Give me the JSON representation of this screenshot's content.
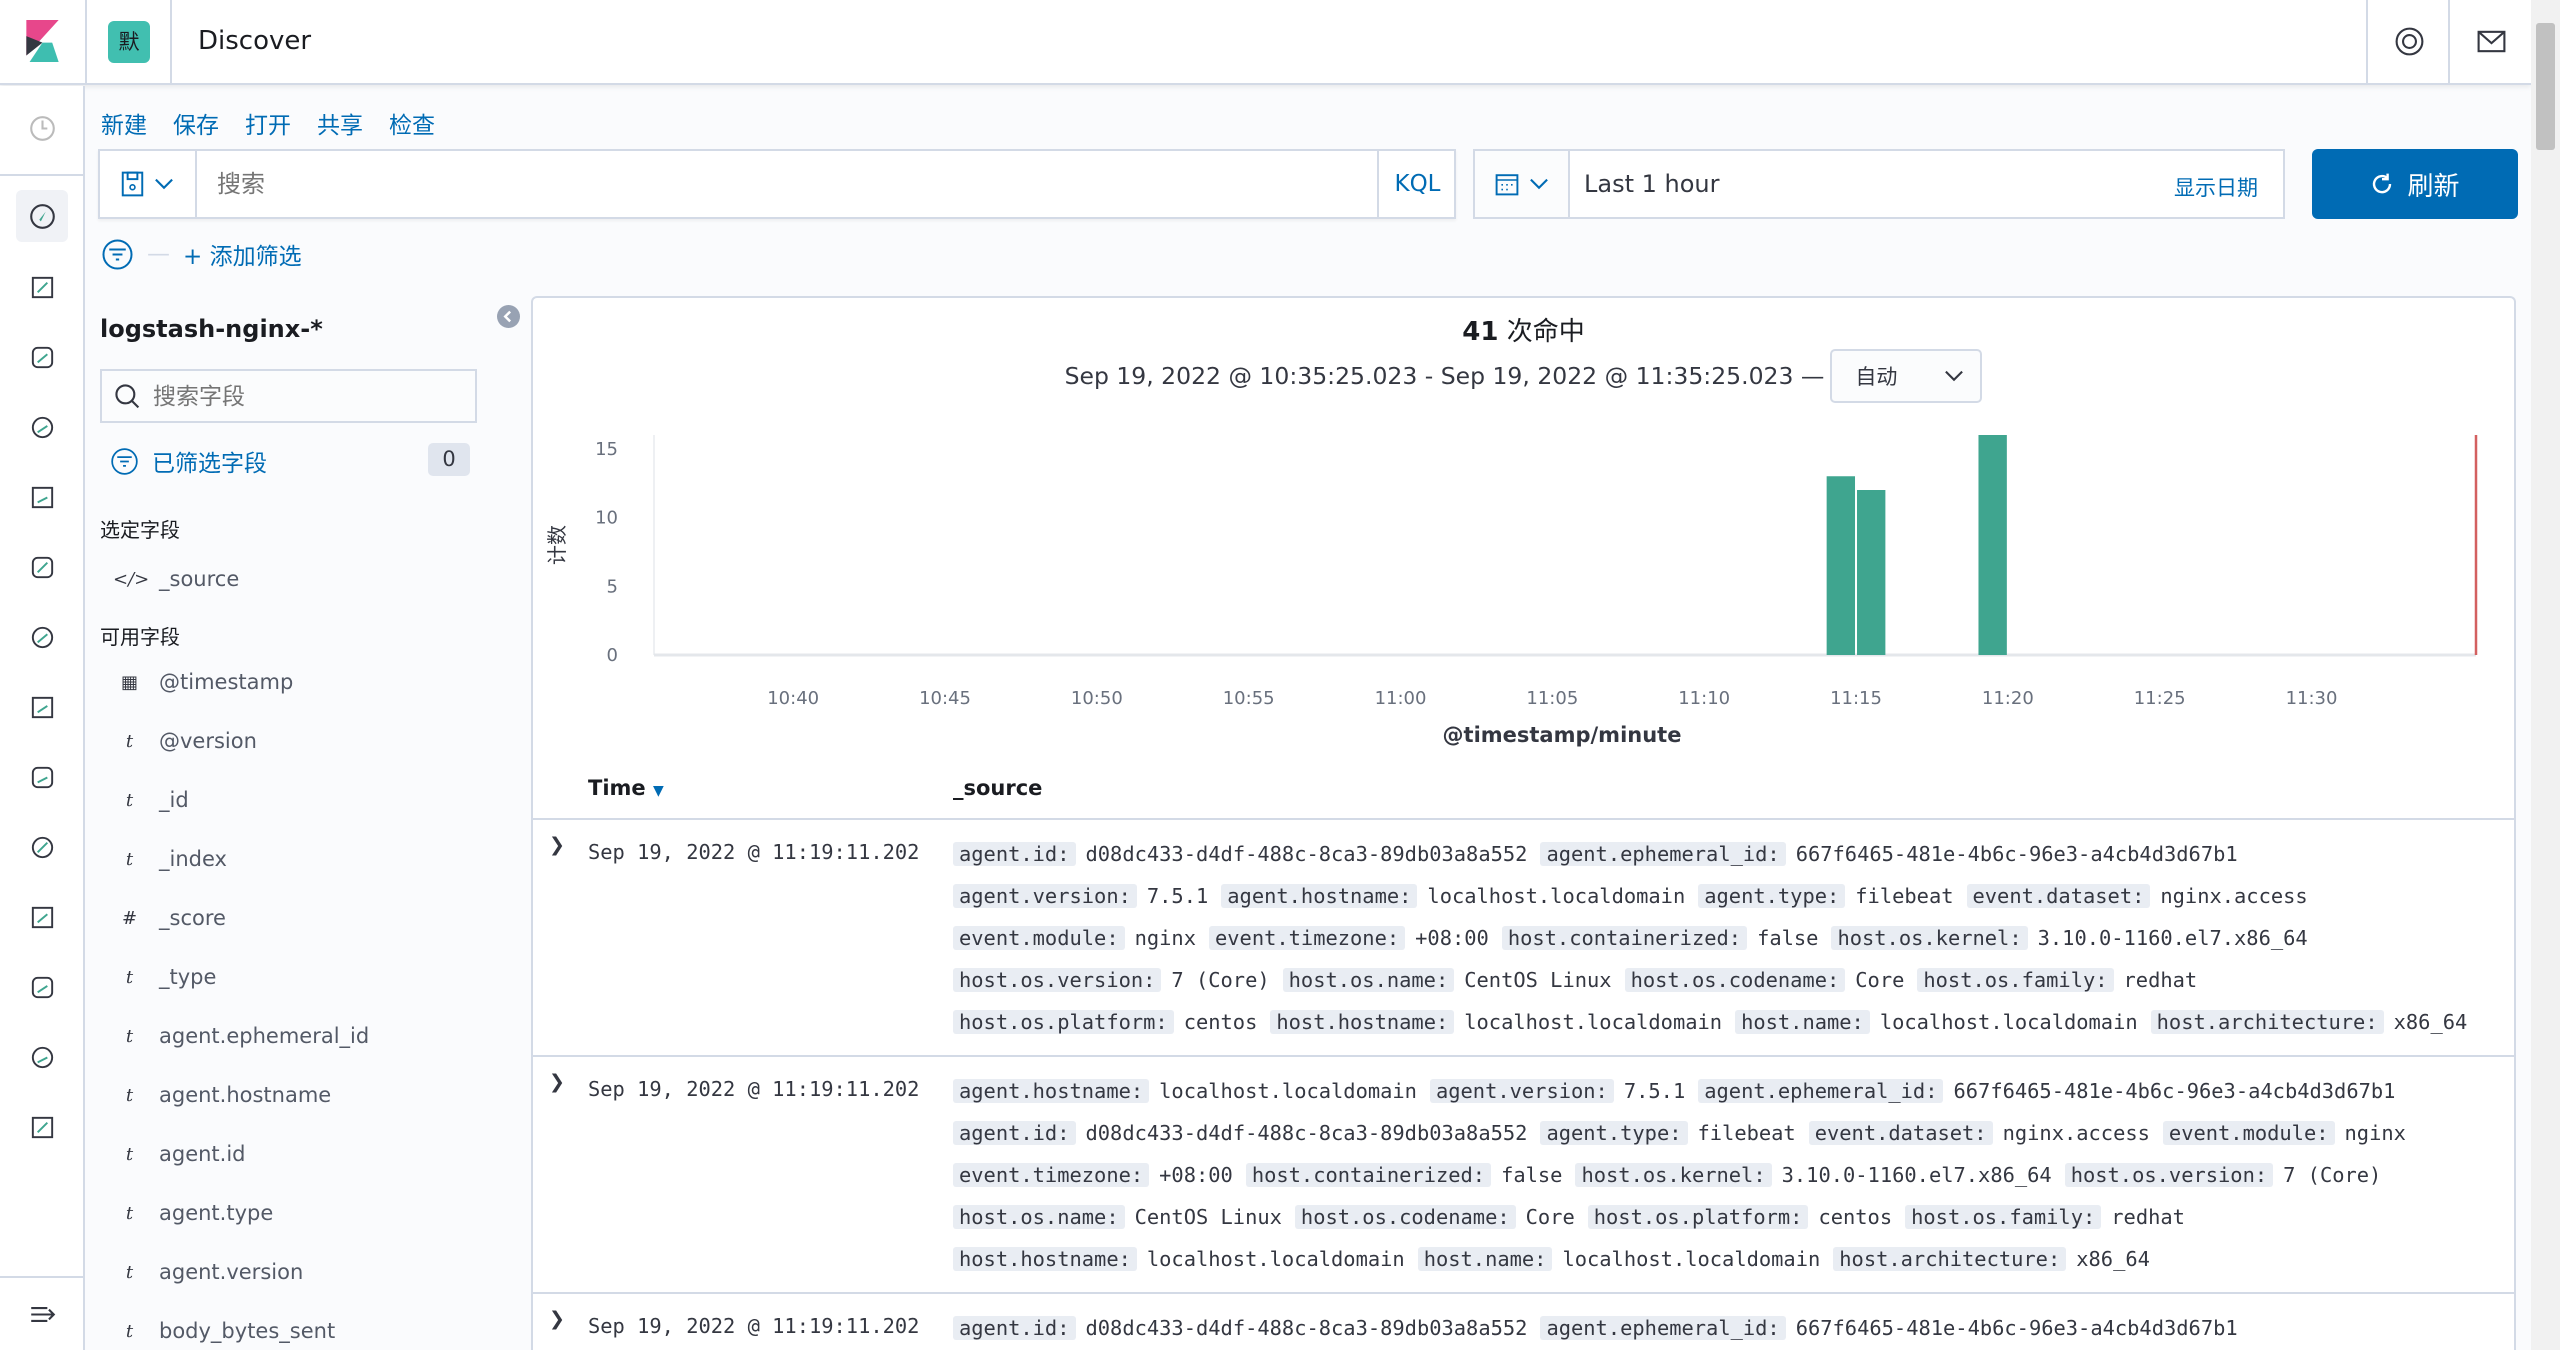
{
  "header": {
    "space_badge": "默",
    "title": "Discover",
    "icons": [
      "help-icon",
      "mail-icon"
    ]
  },
  "menu": {
    "items": [
      "新建",
      "保存",
      "打开",
      "共享",
      "检查"
    ]
  },
  "query": {
    "placeholder": "搜索",
    "language": "KQL"
  },
  "date": {
    "value": "Last 1 hour",
    "show_dates": "显示日期",
    "refresh": "刷新"
  },
  "filters": {
    "add": "+ 添加筛选"
  },
  "sidebar": {
    "index_pattern": "logstash-nginx-*",
    "search_placeholder": "搜索字段",
    "filtered_label": "已筛选字段",
    "filtered_count": "0",
    "selected_title": "选定字段",
    "selected": [
      {
        "type": "source",
        "name": "_source"
      }
    ],
    "available_title": "可用字段",
    "available": [
      {
        "type": "date",
        "name": "@timestamp"
      },
      {
        "type": "t",
        "name": "@version"
      },
      {
        "type": "t",
        "name": "_id"
      },
      {
        "type": "t",
        "name": "_index"
      },
      {
        "type": "#",
        "name": "_score"
      },
      {
        "type": "t",
        "name": "_type"
      },
      {
        "type": "t",
        "name": "agent.ephemeral_id"
      },
      {
        "type": "t",
        "name": "agent.hostname"
      },
      {
        "type": "t",
        "name": "agent.id"
      },
      {
        "type": "t",
        "name": "agent.type"
      },
      {
        "type": "t",
        "name": "agent.version"
      },
      {
        "type": "t",
        "name": "body_bytes_sent"
      }
    ]
  },
  "hits": {
    "count": "41",
    "label": "次命中",
    "range": "Sep 19, 2022 @ 10:35:25.023 - Sep 19, 2022 @ 11:35:25.023 —",
    "interval": "自动"
  },
  "chart_data": {
    "type": "bar",
    "xlabel": "@timestamp/minute",
    "ylabel": "计数",
    "x_range": [
      "10:35:25",
      "11:35:25"
    ],
    "ylim": [
      0,
      16
    ],
    "y_ticks": [
      "0",
      "5",
      "10",
      "15"
    ],
    "x_ticks": [
      "10:40",
      "10:45",
      "10:50",
      "10:55",
      "11:00",
      "11:05",
      "11:10",
      "11:15",
      "11:20",
      "11:25",
      "11:30"
    ],
    "categories": [
      "11:14",
      "11:15",
      "11:19"
    ],
    "values": [
      13,
      12,
      16
    ],
    "bar_color": "#3fa58f",
    "now_line_color": "#d36060"
  },
  "table": {
    "columns": [
      "Time",
      "_source"
    ],
    "rows": [
      {
        "time": "Sep 19, 2022 @ 11:19:11.202",
        "fields": [
          [
            "agent.id:",
            "d08dc433-d4df-488c-8ca3-89db03a8a552"
          ],
          [
            "agent.ephemeral_id:",
            "667f6465-481e-4b6c-96e3-a4cb4d3d67b1"
          ],
          [
            "agent.version:",
            "7.5.1"
          ],
          [
            "agent.hostname:",
            "localhost.localdomain"
          ],
          [
            "agent.type:",
            "filebeat"
          ],
          [
            "event.dataset:",
            "nginx.access"
          ],
          [
            "event.module:",
            "nginx"
          ],
          [
            "event.timezone:",
            "+08:00"
          ],
          [
            "host.containerized:",
            "false"
          ],
          [
            "host.os.kernel:",
            "3.10.0-1160.el7.x86_64"
          ],
          [
            "host.os.version:",
            "7 (Core)"
          ],
          [
            "host.os.name:",
            "CentOS Linux"
          ],
          [
            "host.os.codename:",
            "Core"
          ],
          [
            "host.os.family:",
            "redhat"
          ],
          [
            "host.os.platform:",
            "centos"
          ],
          [
            "host.hostname:",
            "localhost.localdomain"
          ],
          [
            "host.name:",
            "localhost.localdomain"
          ],
          [
            "host.architecture:",
            "x86_64"
          ]
        ]
      },
      {
        "time": "Sep 19, 2022 @ 11:19:11.202",
        "fields": [
          [
            "agent.hostname:",
            "localhost.localdomain"
          ],
          [
            "agent.version:",
            "7.5.1"
          ],
          [
            "agent.ephemeral_id:",
            "667f6465-481e-4b6c-96e3-a4cb4d3d67b1"
          ],
          [
            "agent.id:",
            "d08dc433-d4df-488c-8ca3-89db03a8a552"
          ],
          [
            "agent.type:",
            "filebeat"
          ],
          [
            "event.dataset:",
            "nginx.access"
          ],
          [
            "event.module:",
            "nginx"
          ],
          [
            "event.timezone:",
            "+08:00"
          ],
          [
            "host.containerized:",
            "false"
          ],
          [
            "host.os.kernel:",
            "3.10.0-1160.el7.x86_64"
          ],
          [
            "host.os.version:",
            "7 (Core)"
          ],
          [
            "host.os.name:",
            "CentOS Linux"
          ],
          [
            "host.os.codename:",
            "Core"
          ],
          [
            "host.os.platform:",
            "centos"
          ],
          [
            "host.os.family:",
            "redhat"
          ],
          [
            "host.hostname:",
            "localhost.localdomain"
          ],
          [
            "host.name:",
            "localhost.localdomain"
          ],
          [
            "host.architecture:",
            "x86_64"
          ]
        ]
      },
      {
        "time": "Sep 19, 2022 @ 11:19:11.202",
        "fields": [
          [
            "agent.id:",
            "d08dc433-d4df-488c-8ca3-89db03a8a552"
          ],
          [
            "agent.ephemeral_id:",
            "667f6465-481e-4b6c-96e3-a4cb4d3d67b1"
          ]
        ]
      }
    ]
  }
}
